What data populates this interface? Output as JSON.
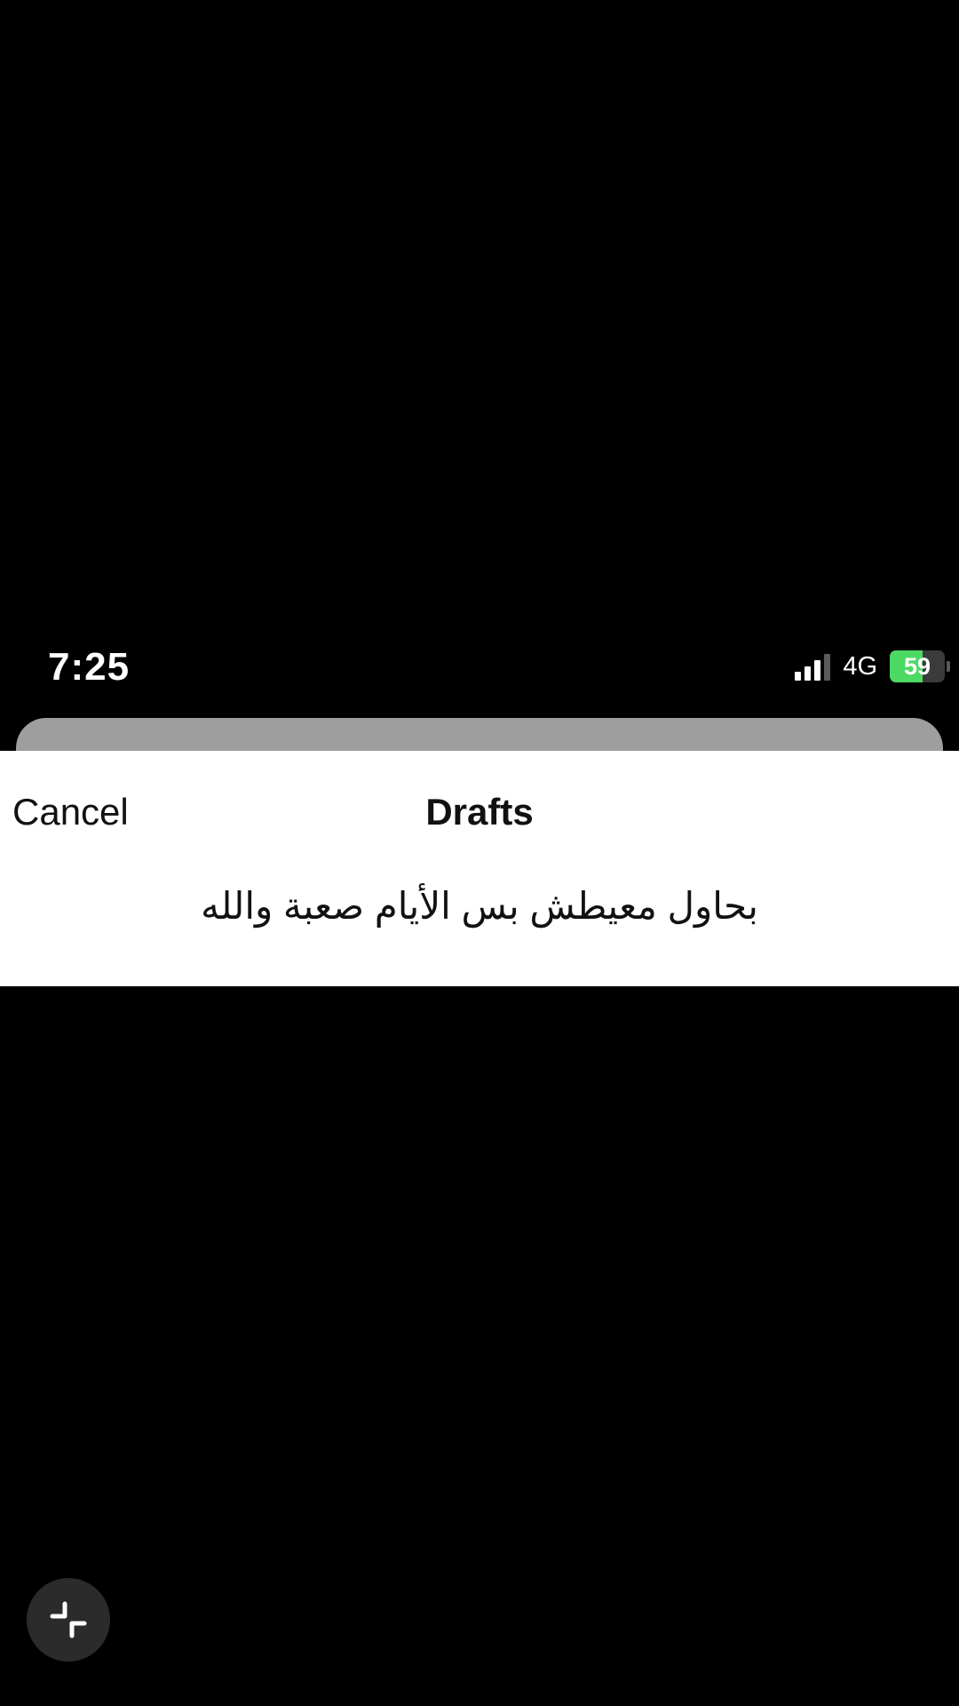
{
  "status_bar": {
    "time": "7:25",
    "network": "4G",
    "battery_level": "59",
    "battery_fraction": 0.59,
    "signal_bars_active": 3,
    "signal_bars_total": 4
  },
  "sheet": {
    "cancel_label": "Cancel",
    "title": "Drafts",
    "drafts": [
      {
        "text": "بحاول معيطش بس الأيام صعبة والله"
      }
    ]
  },
  "controls": {
    "minimize_icon": "minimize-arrows-icon"
  },
  "colors": {
    "background": "#000000",
    "sheet": "#ffffff",
    "battery_fill": "#4cd964",
    "handle_card": "#9e9e9e"
  }
}
